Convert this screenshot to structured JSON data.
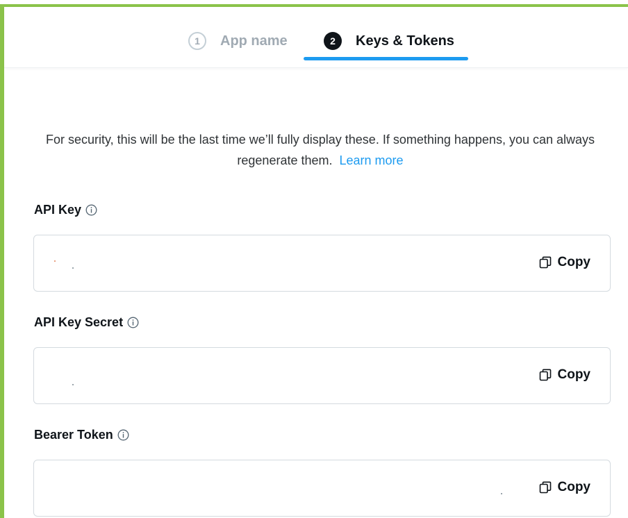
{
  "stepper": {
    "steps": [
      {
        "number": "1",
        "label": "App name",
        "state": "inactive"
      },
      {
        "number": "2",
        "label": "Keys & Tokens",
        "state": "active"
      }
    ],
    "accent_color": "#1d9bf0"
  },
  "notice": {
    "text": "For security, this will be the last time we’ll fully display these. If something happens, you can always regenerate them.",
    "link_text": "Learn more"
  },
  "fields": [
    {
      "label": "API Key",
      "value": "",
      "copy_label": "Copy"
    },
    {
      "label": "API Key Secret",
      "value": "",
      "copy_label": "Copy"
    },
    {
      "label": "Bearer Token",
      "value": "",
      "copy_label": "Copy"
    }
  ],
  "icons": {
    "info": "info-circle-icon",
    "copy": "copy-icon"
  }
}
